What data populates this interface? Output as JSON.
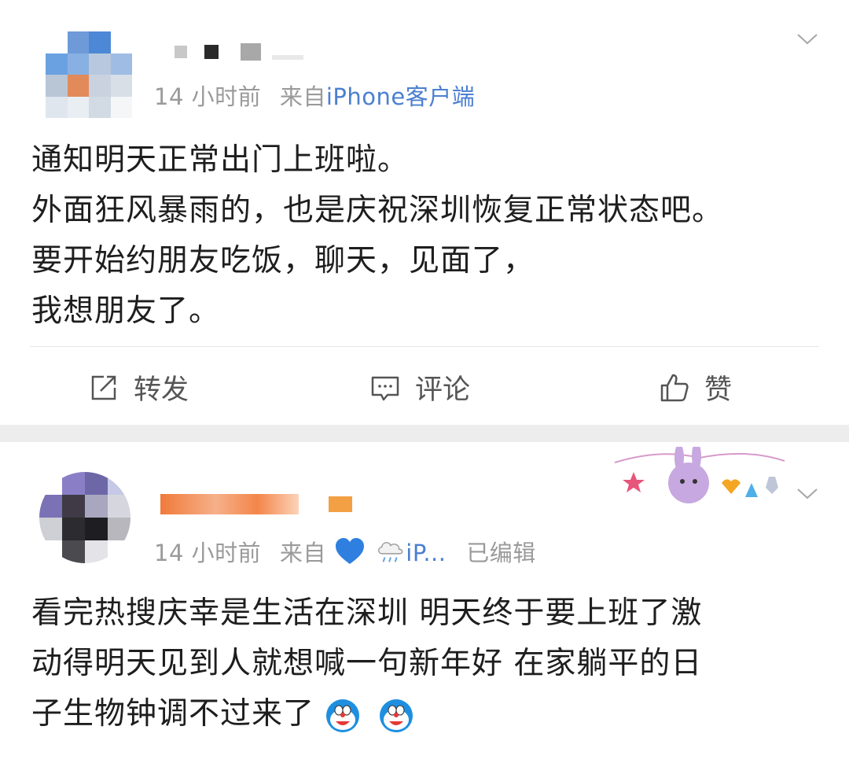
{
  "post1": {
    "meta": {
      "time": "14 小时前",
      "from_label": "来自",
      "source": "iPhone客户端"
    },
    "content_lines": [
      "通知明天正常出门上班啦。",
      "外面狂风暴雨的，也是庆祝深圳恢复正常状态吧。",
      "要开始约朋友吃饭，聊天，见面了，",
      "我想朋友了。"
    ],
    "actions": {
      "repost": "转发",
      "comment": "评论",
      "like": "赞"
    }
  },
  "post2": {
    "meta": {
      "time": "14 小时前",
      "from_label": "来自",
      "source_suffix": "iP...",
      "edited": "已编辑"
    },
    "content_lines": [
      "看完热搜庆幸是生活在深圳 明天终于要上班了激",
      "动得明天见到人就想喊一句新年好 在家躺平的日",
      "子生物钟调不过来了"
    ]
  },
  "colors": {
    "link_blue": "#4b7fd1",
    "meta_gray": "#9a9a9a",
    "separator": "#ededed"
  }
}
